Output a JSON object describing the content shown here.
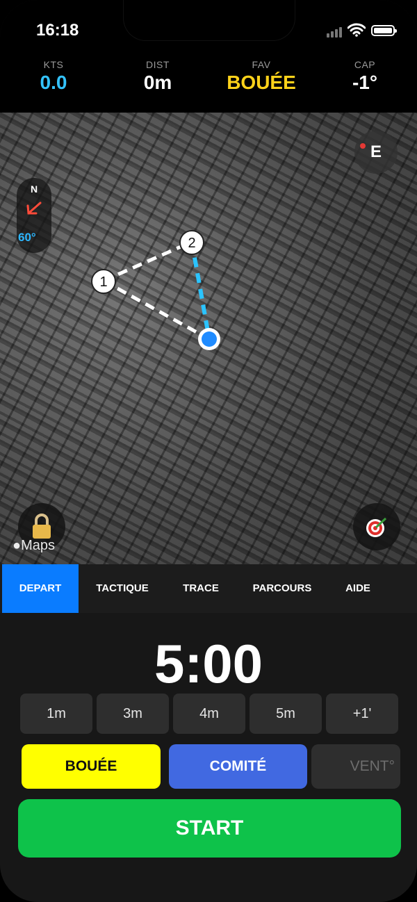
{
  "status_bar": {
    "time": "16:18"
  },
  "stats": [
    {
      "label": "KTS",
      "value": "0.0",
      "color": "#33c3ff"
    },
    {
      "label": "DIST",
      "value": "0m",
      "color": "#ffffff"
    },
    {
      "label": "FAV",
      "value": "BOUÉE",
      "color": "#ffd21a"
    },
    {
      "label": "CAP",
      "value": "-1°",
      "color": "#ffffff"
    }
  ],
  "map": {
    "compass_north": "N",
    "compass_heading": "60°",
    "east_button": "E",
    "attribution": "Maps",
    "waypoints": [
      "1",
      "2"
    ]
  },
  "tabs": [
    {
      "label": "DEPART",
      "active": true
    },
    {
      "label": "TACTIQUE",
      "active": false
    },
    {
      "label": "TRACE",
      "active": false
    },
    {
      "label": "PARCOURS",
      "active": false
    },
    {
      "label": "AIDE",
      "active": false
    }
  ],
  "timer": "5:00",
  "time_buttons": [
    "1m",
    "3m",
    "4m",
    "5m",
    "+1'"
  ],
  "actions": {
    "bouee": {
      "label": "BOUÉE",
      "color": "#ffff00"
    },
    "comite": {
      "label": "COMITÉ",
      "color": "#4169e1"
    },
    "vent": {
      "label": "VENT°"
    }
  },
  "start_label": "START"
}
